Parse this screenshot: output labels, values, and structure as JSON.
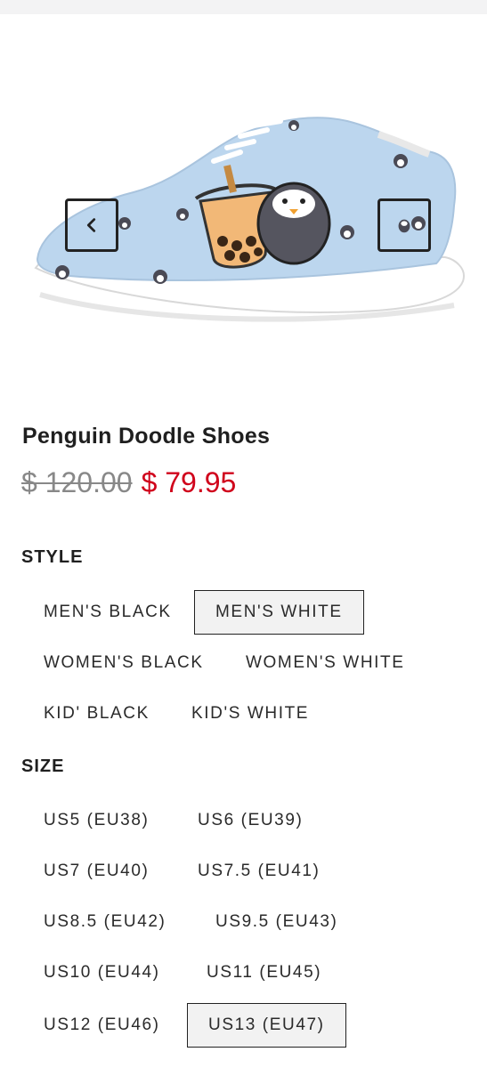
{
  "product": {
    "title": "Penguin Doodle Shoes",
    "price_original": "$ 120.00",
    "price_sale": "$ 79.95"
  },
  "gallery": {
    "prev_icon": "chevron-left-icon",
    "next_icon": "penguin-thumbnail-icon"
  },
  "style": {
    "label": "STYLE",
    "options": [
      "MEN'S BLACK",
      "MEN'S WHITE",
      "WOMEN'S BLACK",
      "WOMEN'S WHITE",
      "KID' BLACK",
      "KID'S WHITE"
    ],
    "selected": "MEN'S WHITE"
  },
  "size": {
    "label": "SIZE",
    "options": [
      "US5 (EU38)",
      "US6 (EU39)",
      "US7 (EU40)",
      "US7.5 (EU41)",
      "US8.5 (EU42)",
      "US9.5 (EU43)",
      "US10 (EU44)",
      "US11 (EU45)",
      "US12 (EU46)",
      "US13 (EU47)"
    ],
    "selected": "US13 (EU47)"
  },
  "colors": {
    "sale": "#d0021b",
    "shoe_body": "#bcd6ee",
    "border": "#222222"
  }
}
